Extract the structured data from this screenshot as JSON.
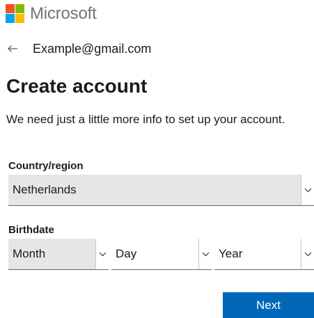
{
  "brand": {
    "name": "Microsoft",
    "colors": {
      "red": "#f25022",
      "green": "#7fba00",
      "blue": "#00a4ef",
      "yellow": "#ffb900"
    }
  },
  "identity": {
    "back_icon": "back-arrow-icon",
    "email": "Example@gmail.com"
  },
  "form": {
    "title": "Create account",
    "description": "We need just a little more info to set up your account.",
    "country": {
      "label": "Country/region",
      "value": "Netherlands"
    },
    "birthdate": {
      "label": "Birthdate",
      "month": "Month",
      "day": "Day",
      "year": "Year"
    },
    "next_label": "Next"
  },
  "colors": {
    "accent": "#0067b8",
    "select_bg": "#e6e6e6"
  }
}
